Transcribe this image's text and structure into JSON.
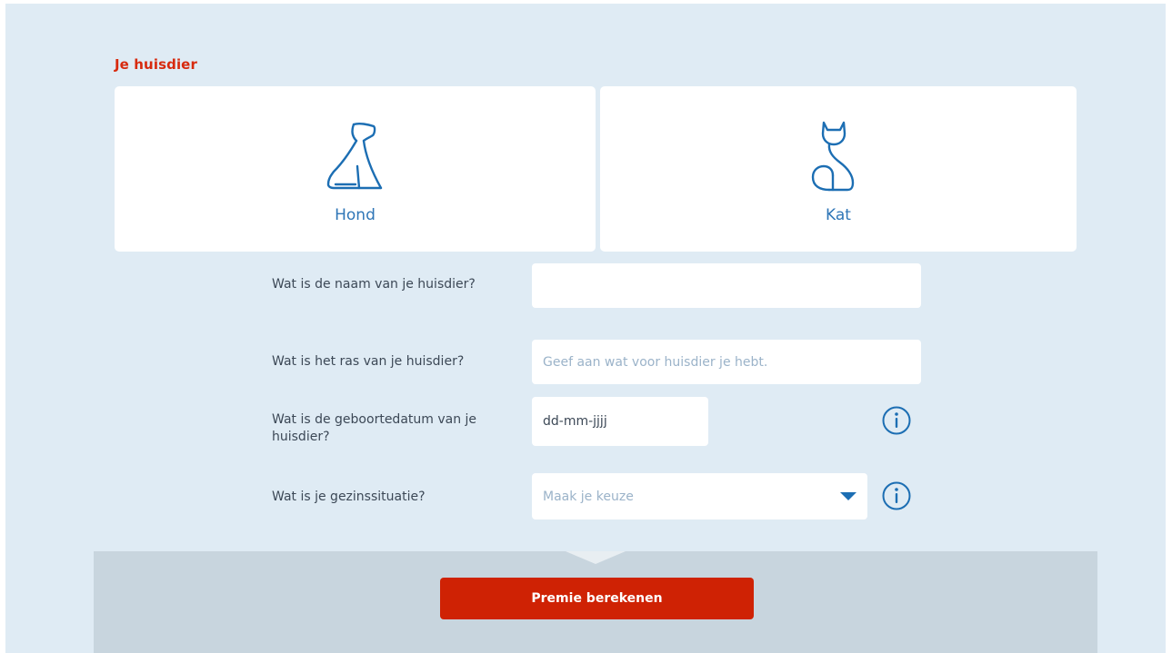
{
  "section": {
    "title": "Je huisdier"
  },
  "pets": [
    {
      "label": "Hond",
      "icon": "dog-icon"
    },
    {
      "label": "Kat",
      "icon": "cat-icon"
    }
  ],
  "form": {
    "name": {
      "label": "Wat is de naam van je huisdier?",
      "value": ""
    },
    "breed": {
      "label": "Wat is het ras van je huisdier?",
      "placeholder": "Geef aan wat voor huisdier je hebt."
    },
    "birthdate": {
      "label": "Wat is de geboortedatum van je huisdier?",
      "value": "dd-mm-jjjj",
      "info_icon": "info-icon"
    },
    "family": {
      "label": "Wat is je gezinssituatie?",
      "placeholder": "Maak je keuze",
      "info_icon": "info-icon"
    }
  },
  "footer": {
    "cta_label": "Premie berekenen"
  },
  "colors": {
    "accent_red": "#cf2204",
    "title_red": "#d72a0e",
    "icon_blue": "#1c6eb3",
    "panel_bg": "#dfebf4",
    "footer_bg": "#c8d5de"
  }
}
